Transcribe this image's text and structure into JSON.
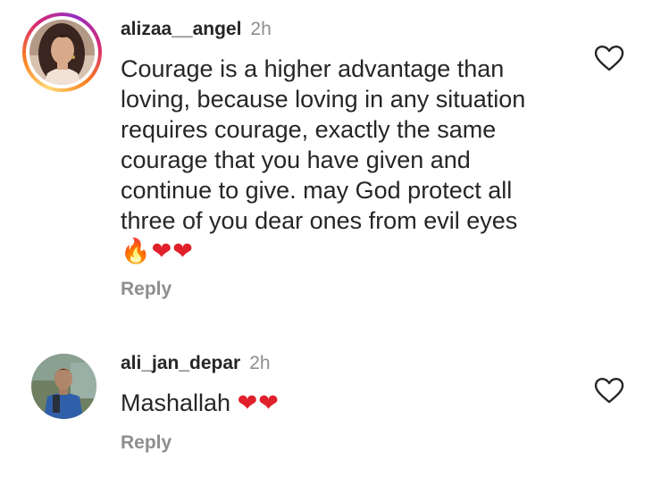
{
  "comments": [
    {
      "username": "alizaa__angel",
      "time": "2h",
      "text_lines": [
        "Courage is a higher advantage than",
        "loving, because loving in any situation",
        "requires courage, exactly the same",
        "courage that you have given and",
        "continue to give. may God protect all",
        "three of you dear ones from evil eyes"
      ],
      "emojis": "🔥❤❤",
      "reply_label": "Reply",
      "avatar_story_ring": true,
      "like_icon": "heart-outline-icon"
    },
    {
      "username": "ali_jan_depar",
      "time": "2h",
      "text": "Mashallah",
      "emojis": "❤❤",
      "reply_label": "Reply",
      "avatar_story_ring": false,
      "like_icon": "heart-outline-icon"
    }
  ],
  "colors": {
    "text_primary": "#262626",
    "text_secondary": "#8e8e8e",
    "heart_red": "#e0202a",
    "story_ring": [
      "#feda75",
      "#fa7e1e",
      "#d62976",
      "#962fbf"
    ]
  }
}
